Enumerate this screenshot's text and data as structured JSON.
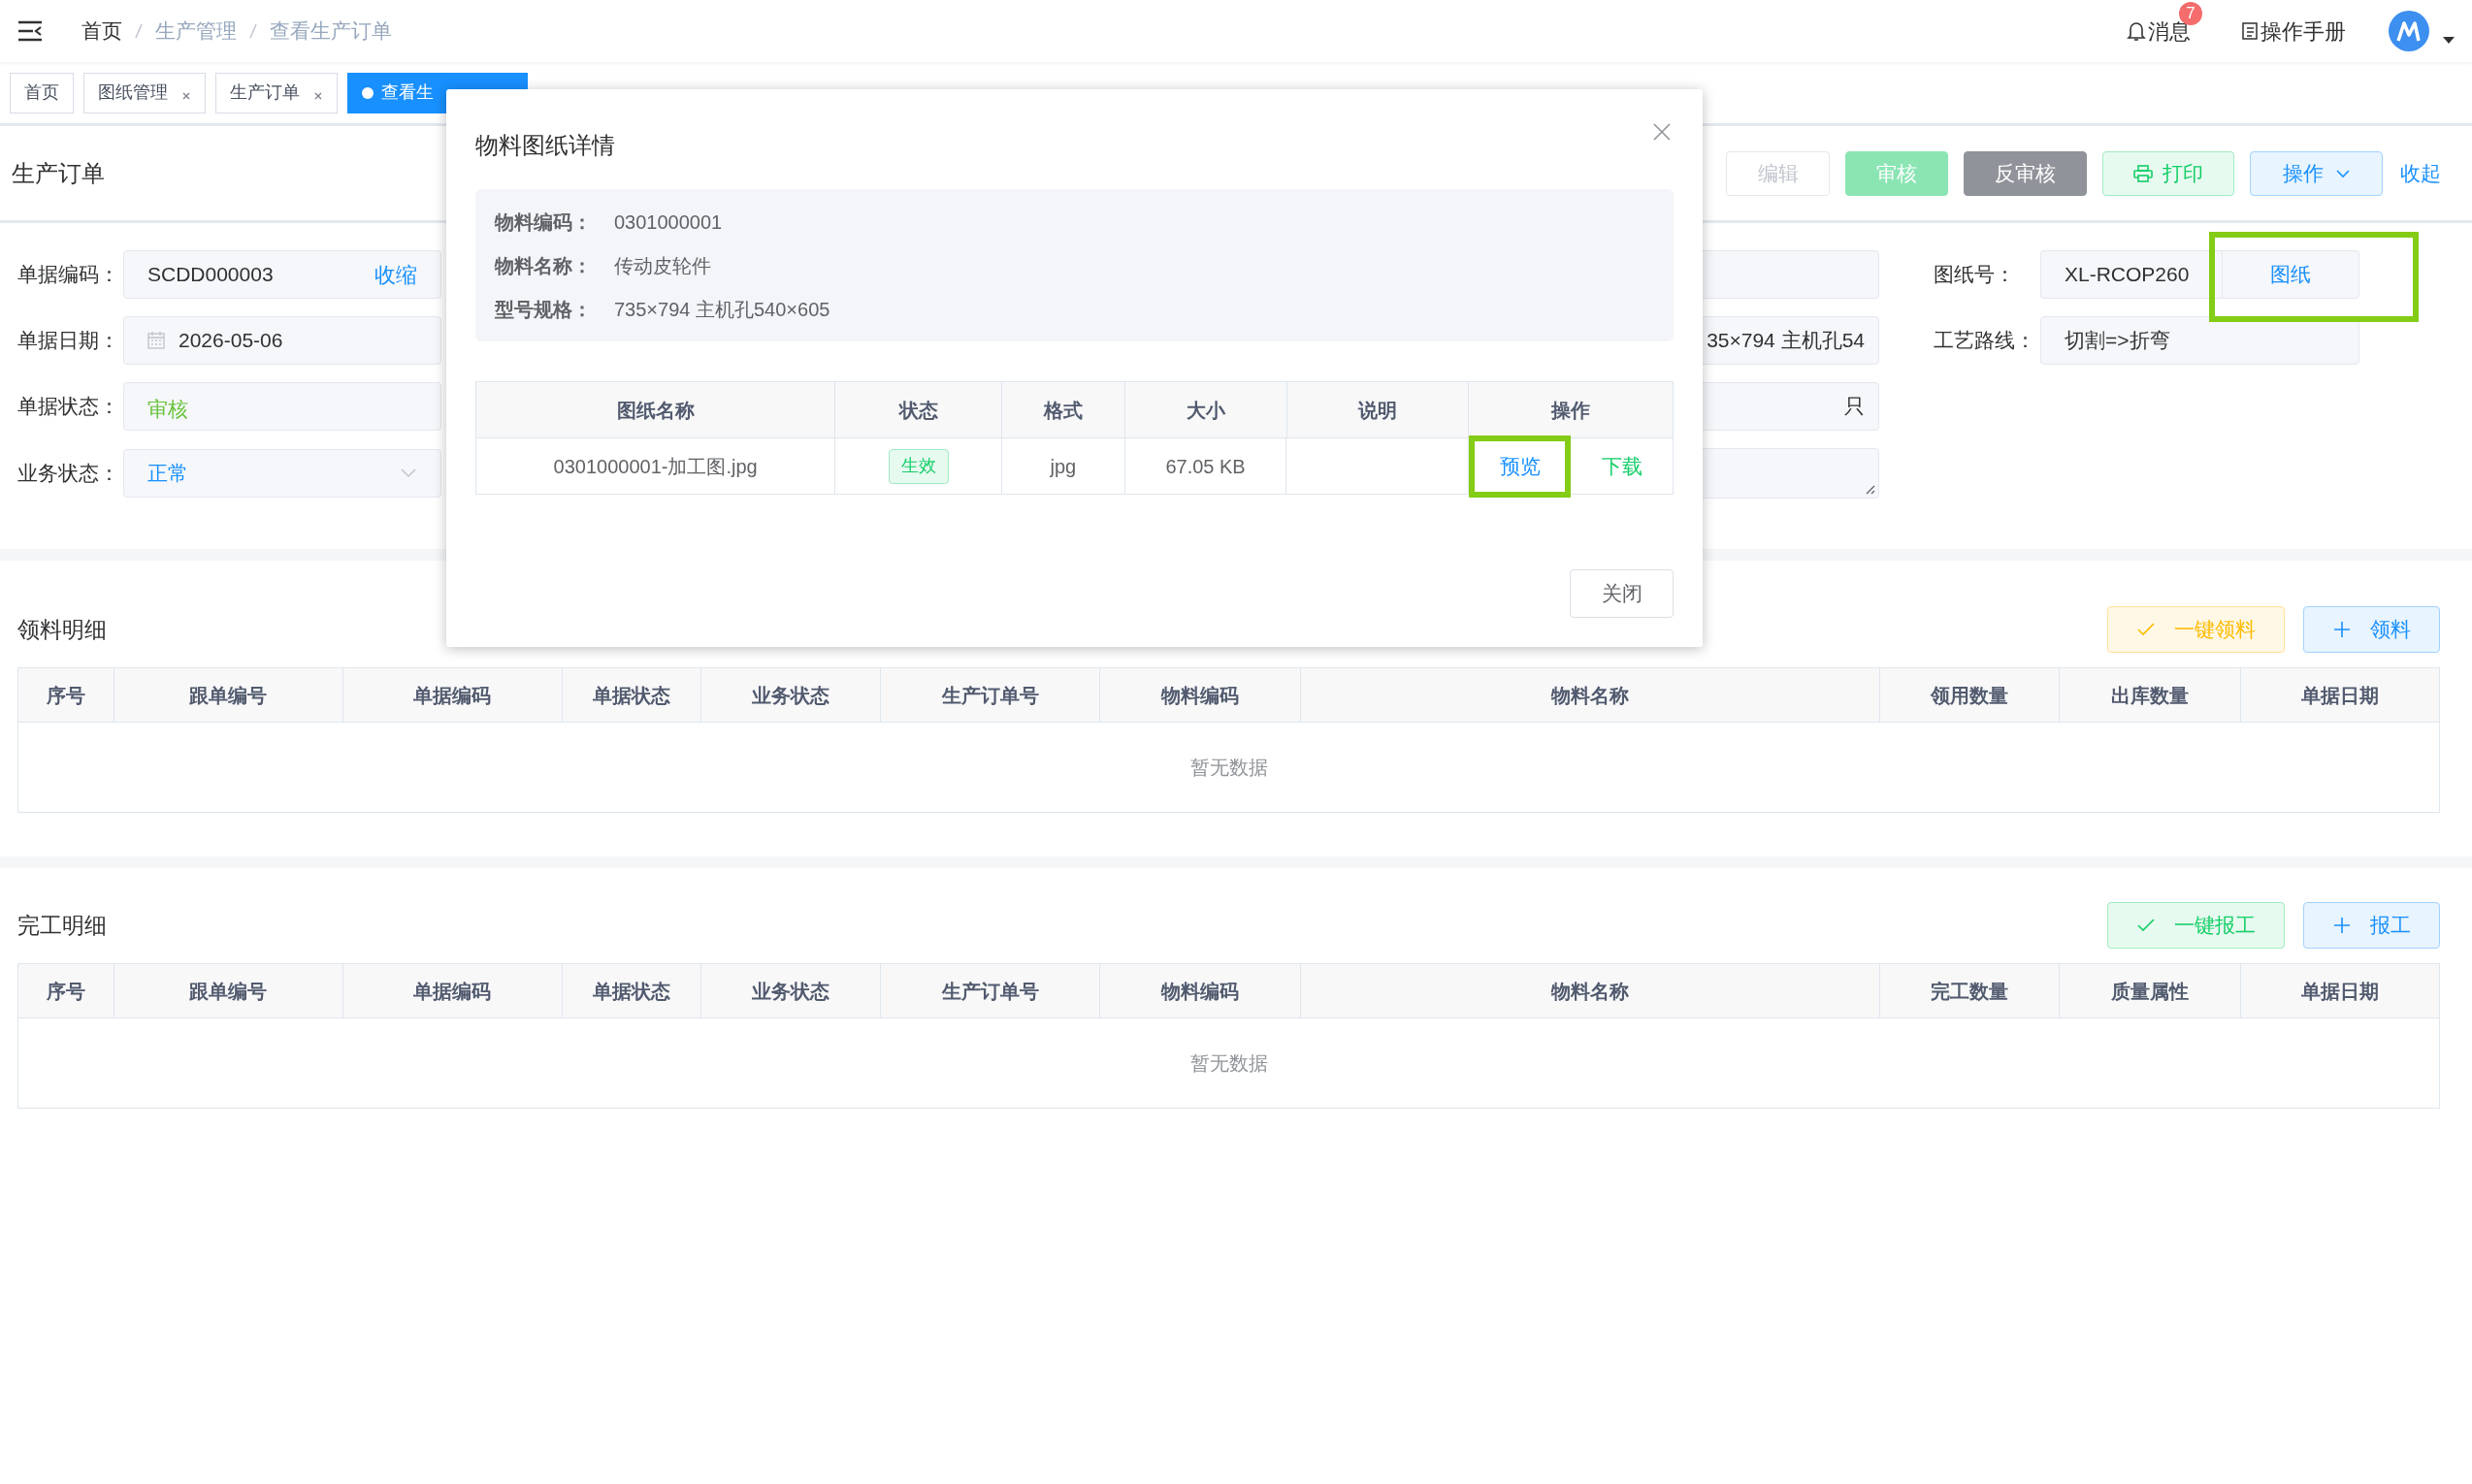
{
  "header": {
    "breadcrumb": [
      {
        "label": "首页",
        "link": true
      },
      {
        "label": "生产管理",
        "link": false
      },
      {
        "label": "查看生产订单",
        "link": false
      }
    ],
    "messages": {
      "label": "消息",
      "badge": "7"
    },
    "manual": "操作手册"
  },
  "tabs": [
    {
      "label": "首页",
      "selected": false,
      "closable": false
    },
    {
      "label": "图纸管理",
      "selected": false,
      "closable": true
    },
    {
      "label": "生产订单",
      "selected": false,
      "closable": true
    },
    {
      "label": "查看生",
      "selected": true,
      "closable": false
    }
  ],
  "order": {
    "title": "生产订单",
    "actions": [
      {
        "label": "编辑",
        "kind": "disabled"
      },
      {
        "label": "审核",
        "kind": "success"
      },
      {
        "label": "反审核",
        "kind": "dark"
      },
      {
        "label": "打印",
        "kind": "print"
      },
      {
        "label": "操作",
        "kind": "menu"
      }
    ],
    "collapse": "收起",
    "rows": [
      {
        "left": {
          "label": "单据编码：",
          "kind": "text",
          "value": "SCDD000003",
          "suffix": "收缩"
        },
        "middle": {
          "kind": "input"
        },
        "right": {
          "label": "图纸号：",
          "value": "XL-RCOP260",
          "button": "图纸",
          "highlighted": true
        }
      },
      {
        "left": {
          "label": "单据日期：",
          "kind": "date",
          "value": "2026-05-06"
        },
        "middle": {
          "kind": "input",
          "value": "35×794 主机孔54"
        },
        "right": {
          "label": "工艺路线：",
          "value": "切割=>折弯"
        }
      },
      {
        "left": {
          "label": "单据状态：",
          "kind": "status",
          "value": "审核"
        },
        "middle": {
          "kind": "input",
          "value": "只"
        }
      },
      {
        "left": {
          "label": "业务状态：",
          "kind": "select",
          "value": "正常"
        },
        "middle": {
          "kind": "textarea"
        }
      }
    ]
  },
  "sections": [
    {
      "title": "领料明细",
      "buttons": [
        {
          "label": "一键领料",
          "kind": "warning"
        },
        {
          "label": "领料",
          "kind": "add"
        }
      ],
      "columns": [
        "序号",
        "跟单编号",
        "单据编码",
        "单据状态",
        "业务状态",
        "生产订单号",
        "物料编码",
        "物料名称",
        "领用数量",
        "出库数量",
        "单据日期"
      ],
      "empty_text": "暂无数据"
    },
    {
      "title": "完工明细",
      "buttons": [
        {
          "label": "一键报工",
          "kind": "success"
        },
        {
          "label": "报工",
          "kind": "add"
        }
      ],
      "columns": [
        "序号",
        "跟单编号",
        "单据编码",
        "单据状态",
        "业务状态",
        "生产订单号",
        "物料编码",
        "物料名称",
        "完工数量",
        "质量属性",
        "单据日期"
      ],
      "empty_text": "暂无数据"
    }
  ],
  "dialog": {
    "title": "物料图纸详情",
    "info": [
      {
        "label": "物料编码：",
        "value": "0301000001"
      },
      {
        "label": "物料名称：",
        "value": "传动皮轮件"
      },
      {
        "label": "型号规格：",
        "value": "735×794 主机孔540×605"
      }
    ],
    "columns": [
      "图纸名称",
      "状态",
      "格式",
      "大小",
      "说明",
      "操作"
    ],
    "rows": [
      {
        "name": "0301000001-加工图.jpg",
        "status": "生效",
        "format": "jpg",
        "size": "67.05 KB",
        "actions": [
          {
            "label": "预览",
            "kind": "preview",
            "highlighted": true
          },
          {
            "label": "下载",
            "kind": "download",
            "highlighted": false
          }
        ]
      }
    ],
    "close_button": "关闭"
  }
}
